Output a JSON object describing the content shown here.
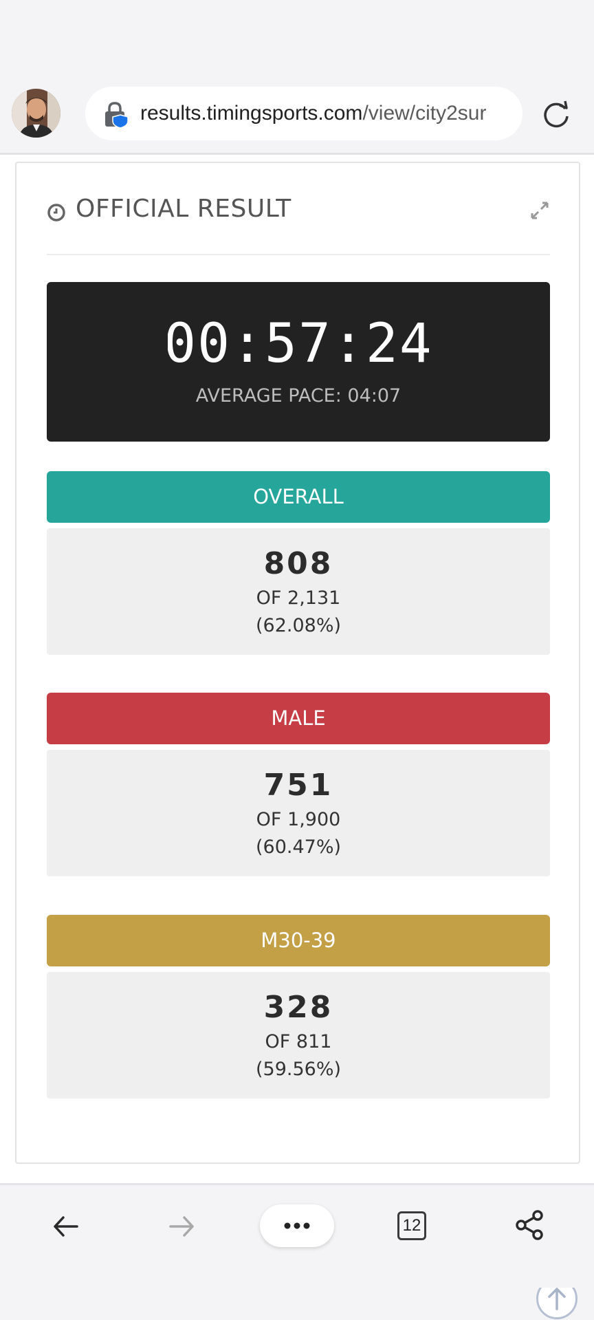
{
  "browser": {
    "url_domain": "results.timingsports.com",
    "url_path": "/view/city2sur",
    "tab_count": "12"
  },
  "result": {
    "title": "OFFICIAL RESULT",
    "time": "00:57:24",
    "pace_label": "AVERAGE PACE: 04:07"
  },
  "rankings": [
    {
      "label": "OVERALL",
      "color": "#26a69a",
      "position": "808",
      "of": "OF 2,131",
      "percent": "(62.08%)"
    },
    {
      "label": "MALE",
      "color": "#c63d45",
      "position": "751",
      "of": "OF 1,900",
      "percent": "(60.47%)"
    },
    {
      "label": "M30-39",
      "color": "#c3a046",
      "position": "328",
      "of": "OF 811",
      "percent": "(59.56%)"
    }
  ],
  "icons": {
    "lock": "lock-shield-icon",
    "reload": "reload-icon",
    "clock": "clock-icon",
    "expand": "expand-icon",
    "scroll_top": "arrow-up-circle-icon",
    "back": "arrow-left-icon",
    "forward": "arrow-right-icon",
    "menu": "more-dots-icon",
    "share": "share-icon"
  }
}
